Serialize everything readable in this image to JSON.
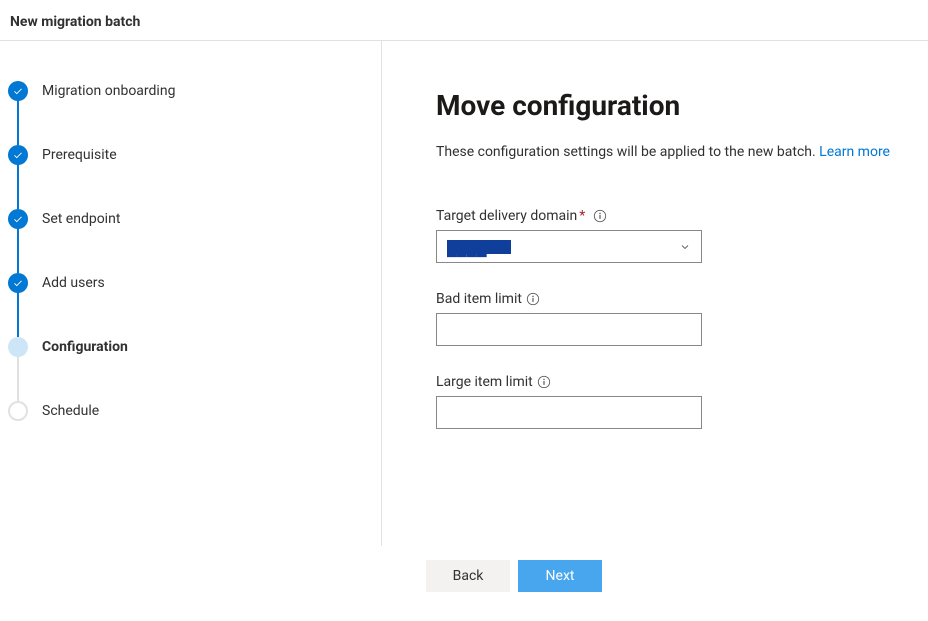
{
  "header": {
    "title": "New migration batch"
  },
  "sidebar": {
    "steps": [
      {
        "label": "Migration onboarding",
        "status": "done"
      },
      {
        "label": "Prerequisite",
        "status": "done"
      },
      {
        "label": "Set endpoint",
        "status": "done"
      },
      {
        "label": "Add users",
        "status": "done"
      },
      {
        "label": "Configuration",
        "status": "current"
      },
      {
        "label": "Schedule",
        "status": "future"
      }
    ]
  },
  "main": {
    "title": "Move configuration",
    "description": "These configuration settings will be applied to the new batch. ",
    "learn_more": "Learn more",
    "fields": {
      "target_domain": {
        "label": "Target delivery domain",
        "required": "*",
        "selected": "████"
      },
      "bad_item_limit": {
        "label": "Bad item limit",
        "value": ""
      },
      "large_item_limit": {
        "label": "Large item limit",
        "value": ""
      }
    }
  },
  "footer": {
    "back": "Back",
    "next": "Next"
  }
}
